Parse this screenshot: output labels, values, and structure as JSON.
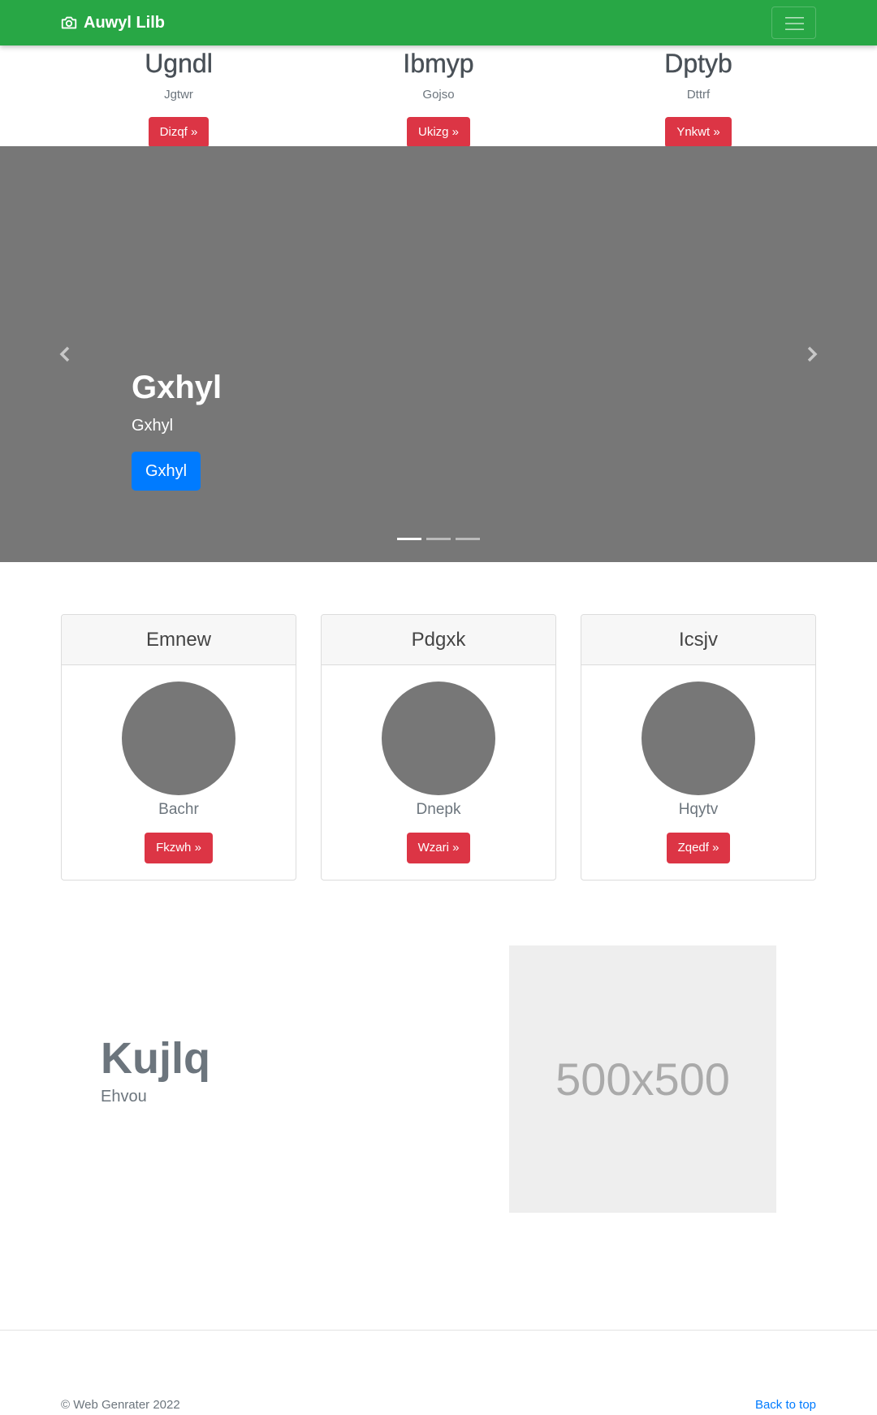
{
  "navbar": {
    "brand": "Auwyl Lilb",
    "brand_icon": "camera-icon",
    "toggler_icon": "hamburger-icon",
    "bg": "#28a745"
  },
  "features": [
    {
      "title": "Ugndl",
      "text": "Jgtwr",
      "button": "Dizqf »"
    },
    {
      "title": "Ibmyp",
      "text": "Gojso",
      "button": "Ukizg »"
    },
    {
      "title": "Dptyb",
      "text": "Dttrf",
      "button": "Ynkwt »"
    }
  ],
  "carousel": {
    "heading": "Gxhyl",
    "text": "Gxhyl",
    "button": "Gxhyl",
    "slides": 3,
    "active_slide": 1
  },
  "cards": [
    {
      "header": "Emnew",
      "name": "Bachr",
      "button": "Fkzwh »"
    },
    {
      "header": "Pdgxk",
      "name": "Dnepk",
      "button": "Wzari »"
    },
    {
      "header": "Icsjv",
      "name": "Hqytv",
      "button": "Zqedf »"
    }
  ],
  "featurette": {
    "heading": "Kujlq",
    "subheading": "Ehvou",
    "image_label": "500x500"
  },
  "footer": {
    "copyright": "© Web Genrater 2022",
    "back_to_top": "Back to top"
  },
  "colors": {
    "danger": "#dc3545",
    "primary": "#007bff",
    "carousel_bg": "#777777"
  }
}
